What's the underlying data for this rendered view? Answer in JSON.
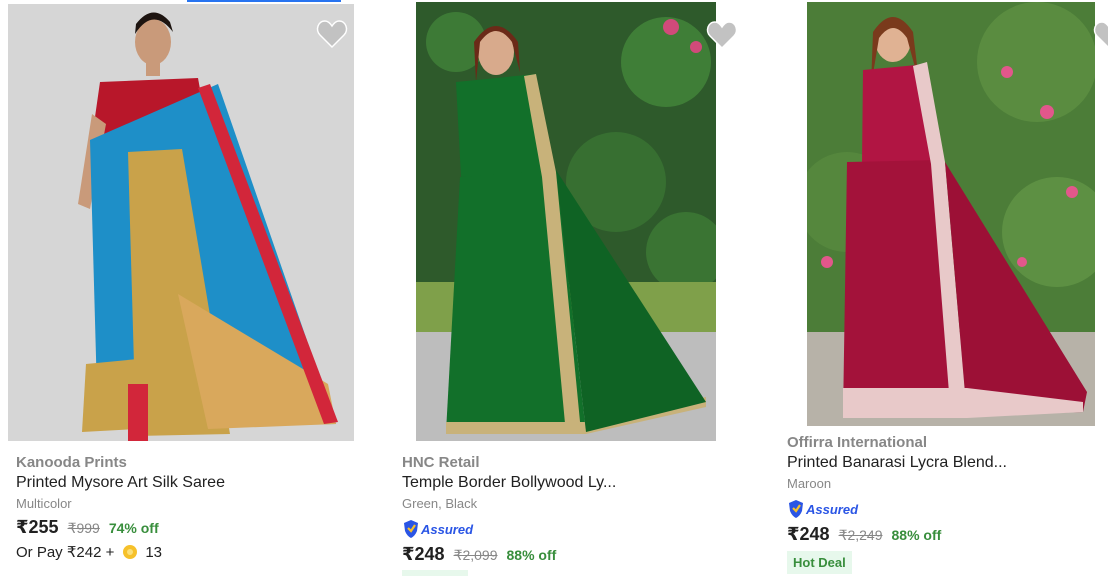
{
  "products": [
    {
      "brand": "Kanooda Prints",
      "title": "Printed Mysore Art Silk Saree",
      "variant": "Multicolor",
      "price": "₹255",
      "mrp": "₹999",
      "discount": "74% off",
      "pay_text": "Or Pay ₹242 +",
      "coins": "13",
      "saree_color": "#1e8fc8",
      "border_color": "#c9a24a"
    },
    {
      "brand": "HNC Retail",
      "title": "Temple Border Bollywood Ly...",
      "variant": "Green, Black",
      "assured_label": "Assured",
      "price": "₹248",
      "mrp": "₹2,099",
      "discount": "88% off",
      "saree_color": "#12702a",
      "border_color": "#c8b27a"
    },
    {
      "brand": "Offirra International",
      "title": "Printed Banarasi Lycra Blend...",
      "variant": "Maroon",
      "assured_label": "Assured",
      "price": "₹248",
      "mrp": "₹2,249",
      "discount": "88% off",
      "deal_label": "Hot Deal",
      "saree_color": "#a3123a",
      "border_color": "#e8c9c9"
    }
  ],
  "icons": {
    "wishlist": "heart-icon",
    "assured": "shield-icon",
    "coin": "supercoin-icon"
  },
  "colors": {
    "discount_green": "#388e3c",
    "assured_blue": "#2a55e5",
    "muted_grey": "#878787",
    "wishlist_grey": "#c2c2c2"
  }
}
